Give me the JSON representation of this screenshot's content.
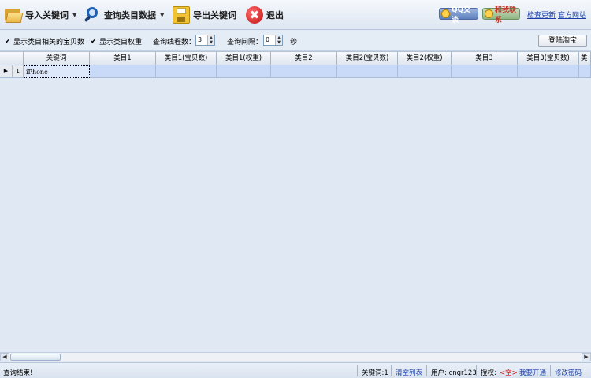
{
  "toolbar": {
    "import_label": "导入关键词",
    "query_label": "查询类目数据",
    "export_label": "导出关键词",
    "exit_label": "退出",
    "exit_glyph": "✖",
    "qq_label": "QQ交谈",
    "contact_label": "和我联系",
    "check_update": "检查更新",
    "official_site": "官方网站",
    "icons": [
      "folder-open-icon",
      "magnifier-icon",
      "floppy-disk-icon",
      "red-x-exit-icon",
      "qq-face-icon",
      "contact-face-icon"
    ]
  },
  "options": {
    "show_bao_count": "显示类目相关的宝贝数",
    "show_weight": "显示类目权重",
    "threads_label": "查询线程数：",
    "threads_value": "3",
    "interval_label": "查询间隔：",
    "interval_value": "0",
    "seconds_unit": "秒",
    "login_button": "登陆淘宝"
  },
  "grid": {
    "columns": [
      "关键词",
      "类目1",
      "类目1(宝贝数)",
      "类目1(权重)",
      "类目2",
      "类目2(宝贝数)",
      "类目2(权重)",
      "类目3",
      "类目3(宝贝数)",
      "类"
    ],
    "rows": [
      {
        "indicator": "▶",
        "num": "1",
        "keyword": "iPhone"
      }
    ]
  },
  "scrollbar": {
    "left": "◀",
    "right": "▶"
  },
  "status": {
    "message": "查询结束!",
    "keyword_count": "关键词:1",
    "clear_list": "清空列表",
    "user": "用户: cngr123",
    "auth_label": "授权:",
    "auth_value": "<空>",
    "activate": "我要开通",
    "change_password": "修改密码"
  },
  "colors": {
    "background": "#dfe8f3",
    "selected_row": "#c8daf7",
    "link": "#1a3ea8",
    "auth_red": "#d01010"
  }
}
